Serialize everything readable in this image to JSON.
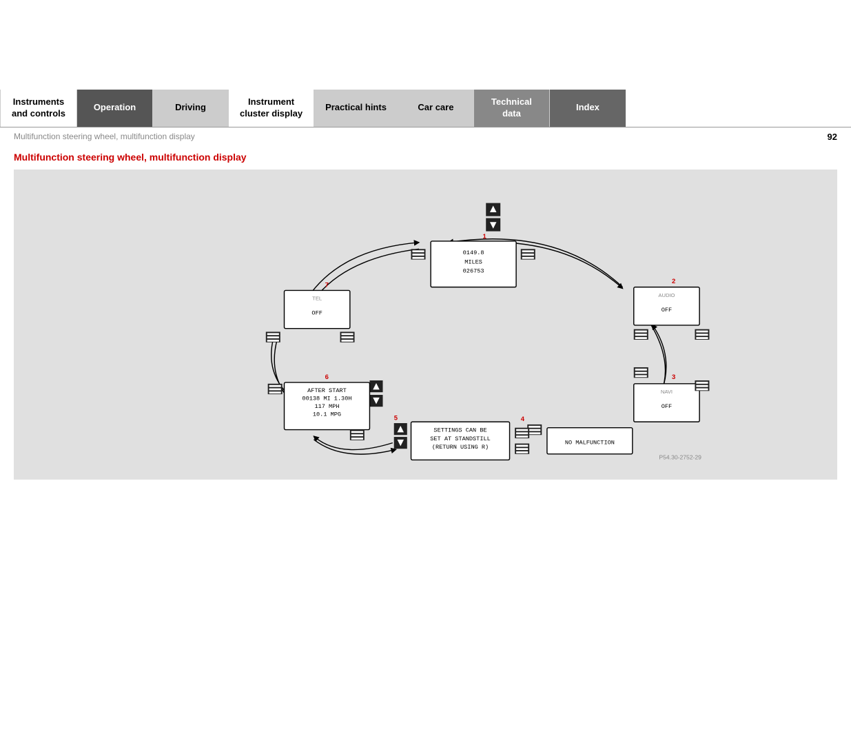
{
  "nav": {
    "items": [
      {
        "label": "Instruments\nand controls",
        "style": "active",
        "id": "instruments-and-controls"
      },
      {
        "label": "Operation",
        "style": "dark",
        "id": "operation"
      },
      {
        "label": "Driving",
        "style": "light",
        "id": "driving"
      },
      {
        "label": "Instrument\ncluster display",
        "style": "light",
        "id": "instrument-cluster-display"
      },
      {
        "label": "Practical hints",
        "style": "light",
        "id": "practical-hints"
      },
      {
        "label": "Car care",
        "style": "light",
        "id": "car-care"
      },
      {
        "label": "Technical\ndata",
        "style": "gray",
        "id": "technical-data"
      },
      {
        "label": "Index",
        "style": "dark-gray",
        "id": "index"
      }
    ]
  },
  "breadcrumb": {
    "text": "Multifunction steering wheel, multifunction display",
    "page": "92"
  },
  "page_title": "Multifunction steering wheel, multifunction display",
  "diagram": {
    "ref_code": "P54.30-2752-29",
    "nodes": [
      {
        "id": "node1",
        "label": "1",
        "title": "",
        "lines": [
          "0149.8",
          "MILES",
          "026753"
        ]
      },
      {
        "id": "node2",
        "label": "2",
        "title": "AUDIO",
        "lines": [
          "OFF"
        ]
      },
      {
        "id": "node3",
        "label": "3",
        "title": "NAVI",
        "lines": [
          "OFF"
        ]
      },
      {
        "id": "node4",
        "label": "4",
        "title": "",
        "lines": [
          "NO MALFUNCTION"
        ]
      },
      {
        "id": "node5",
        "label": "5",
        "title": "",
        "lines": [
          "SETTINGS CAN BE",
          "SET AT STANDSTILL",
          "(RETURN USING R)"
        ]
      },
      {
        "id": "node6",
        "label": "6",
        "title": "",
        "lines": [
          "AFTER START",
          "00138 MI  1.30H",
          "117 MPH",
          "10.1 MPG"
        ]
      },
      {
        "id": "node7",
        "label": "7",
        "title": "TEL",
        "lines": [
          "OFF"
        ]
      }
    ]
  }
}
